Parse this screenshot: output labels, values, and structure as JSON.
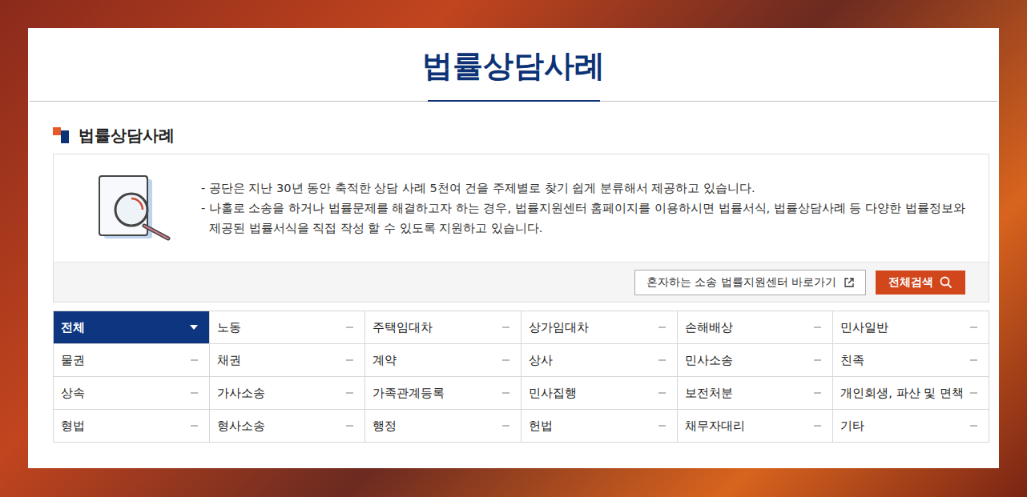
{
  "page": {
    "title": "법률상담사례"
  },
  "section": {
    "title": "법률상담사례"
  },
  "info": {
    "lines": [
      "- 공단은 지난 30년 동안 축적한 상담 사례 5천여 건을 주제별로 찾기 쉽게 분류해서 제공하고 있습니다.",
      "- 나홀로 소송을 하거나 법률문제를 해결하고자 하는 경우, 법률지원센터 홈페이지를 이용하시면 법률서식, 법률상담사례 등 다양한 법률정보와 제공된 법률서식을 직접 작성 할 수 있도록 지원하고 있습니다."
    ]
  },
  "buttons": {
    "external": "혼자하는 소송 법률지원센터 바로가기",
    "search": "전체검색"
  },
  "categories": [
    {
      "label": "전체",
      "selected": true
    },
    {
      "label": "노동",
      "selected": false
    },
    {
      "label": "주택임대차",
      "selected": false
    },
    {
      "label": "상가임대차",
      "selected": false
    },
    {
      "label": "손해배상",
      "selected": false
    },
    {
      "label": "민사일반",
      "selected": false
    },
    {
      "label": "물권",
      "selected": false
    },
    {
      "label": "채권",
      "selected": false
    },
    {
      "label": "계약",
      "selected": false
    },
    {
      "label": "상사",
      "selected": false
    },
    {
      "label": "민사소송",
      "selected": false
    },
    {
      "label": "친족",
      "selected": false
    },
    {
      "label": "상속",
      "selected": false
    },
    {
      "label": "가사소송",
      "selected": false
    },
    {
      "label": "가족관계등록",
      "selected": false
    },
    {
      "label": "민사집행",
      "selected": false
    },
    {
      "label": "보전처분",
      "selected": false
    },
    {
      "label": "개인회생, 파산 및 면책",
      "selected": false
    },
    {
      "label": "형법",
      "selected": false
    },
    {
      "label": "형사소송",
      "selected": false
    },
    {
      "label": "행정",
      "selected": false
    },
    {
      "label": "헌법",
      "selected": false
    },
    {
      "label": "채무자대리",
      "selected": false
    },
    {
      "label": "기타",
      "selected": false
    }
  ]
}
